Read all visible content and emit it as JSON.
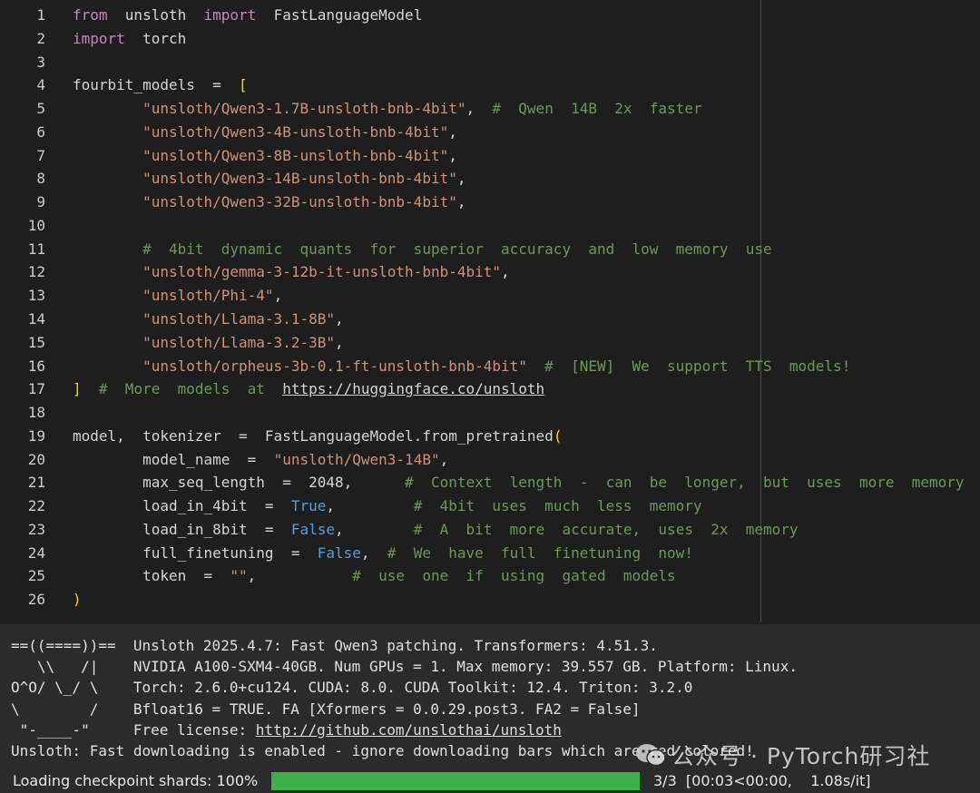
{
  "code_lines": [
    {
      "n": "1",
      "tokens": [
        {
          "t": "from",
          "c": "kw"
        },
        {
          "t": "  unsloth  "
        },
        {
          "t": "import",
          "c": "kw"
        },
        {
          "t": "  FastLanguageModel"
        }
      ]
    },
    {
      "n": "2",
      "tokens": [
        {
          "t": "import",
          "c": "kw"
        },
        {
          "t": "  torch"
        }
      ]
    },
    {
      "n": "3",
      "tokens": []
    },
    {
      "n": "4",
      "tokens": [
        {
          "t": "fourbit_models  =  "
        },
        {
          "t": "[",
          "c": "br"
        }
      ]
    },
    {
      "n": "5",
      "tokens": [
        {
          "t": "        "
        },
        {
          "t": "\"unsloth/Qwen3-1.7B-unsloth-bnb-4bit\"",
          "c": "str"
        },
        {
          "t": ",  "
        },
        {
          "t": "#  Qwen  14B  2x  faster",
          "c": "cm"
        }
      ]
    },
    {
      "n": "6",
      "tokens": [
        {
          "t": "        "
        },
        {
          "t": "\"unsloth/Qwen3-4B-unsloth-bnb-4bit\"",
          "c": "str"
        },
        {
          "t": ","
        }
      ]
    },
    {
      "n": "7",
      "tokens": [
        {
          "t": "        "
        },
        {
          "t": "\"unsloth/Qwen3-8B-unsloth-bnb-4bit\"",
          "c": "str"
        },
        {
          "t": ","
        }
      ]
    },
    {
      "n": "8",
      "tokens": [
        {
          "t": "        "
        },
        {
          "t": "\"unsloth/Qwen3-14B-unsloth-bnb-4bit\"",
          "c": "str"
        },
        {
          "t": ","
        }
      ]
    },
    {
      "n": "9",
      "tokens": [
        {
          "t": "        "
        },
        {
          "t": "\"unsloth/Qwen3-32B-unsloth-bnb-4bit\"",
          "c": "str"
        },
        {
          "t": ","
        }
      ]
    },
    {
      "n": "10",
      "tokens": []
    },
    {
      "n": "11",
      "tokens": [
        {
          "t": "        "
        },
        {
          "t": "#  4bit  dynamic  quants  for  superior  accuracy  and  low  memory  use",
          "c": "cm"
        }
      ]
    },
    {
      "n": "12",
      "tokens": [
        {
          "t": "        "
        },
        {
          "t": "\"unsloth/gemma-3-12b-it-unsloth-bnb-4bit\"",
          "c": "str"
        },
        {
          "t": ","
        }
      ]
    },
    {
      "n": "13",
      "tokens": [
        {
          "t": "        "
        },
        {
          "t": "\"unsloth/Phi-4\"",
          "c": "str"
        },
        {
          "t": ","
        }
      ]
    },
    {
      "n": "14",
      "tokens": [
        {
          "t": "        "
        },
        {
          "t": "\"unsloth/Llama-3.1-8B\"",
          "c": "str"
        },
        {
          "t": ","
        }
      ]
    },
    {
      "n": "15",
      "tokens": [
        {
          "t": "        "
        },
        {
          "t": "\"unsloth/Llama-3.2-3B\"",
          "c": "str"
        },
        {
          "t": ","
        }
      ]
    },
    {
      "n": "16",
      "tokens": [
        {
          "t": "        "
        },
        {
          "t": "\"unsloth/orpheus-3b-0.1-ft-unsloth-bnb-4bit\"",
          "c": "str"
        },
        {
          "t": "  "
        },
        {
          "t": "#  [NEW]  We  support  TTS  models!",
          "c": "cm"
        }
      ]
    },
    {
      "n": "17",
      "tokens": [
        {
          "t": "]",
          "c": "br"
        },
        {
          "t": "  "
        },
        {
          "t": "#  More  models  at  ",
          "c": "cm"
        },
        {
          "t": "https://huggingface.co/unsloth",
          "c": "url"
        }
      ]
    },
    {
      "n": "18",
      "tokens": []
    },
    {
      "n": "19",
      "tokens": [
        {
          "t": "model,  tokenizer  =  FastLanguageModel.from_pretrained"
        },
        {
          "t": "(",
          "c": "br"
        }
      ]
    },
    {
      "n": "20",
      "tokens": [
        {
          "t": "        model_name  =  "
        },
        {
          "t": "\"unsloth/Qwen3-14B\"",
          "c": "str"
        },
        {
          "t": ","
        }
      ]
    },
    {
      "n": "21",
      "tokens": [
        {
          "t": "        max_seq_length  =  2048,      "
        },
        {
          "t": "#  Context  length  -  can  be  longer,  but  uses  more  memory",
          "c": "cm"
        }
      ]
    },
    {
      "n": "22",
      "tokens": [
        {
          "t": "        load_in_4bit  =  "
        },
        {
          "t": "True",
          "c": "bool"
        },
        {
          "t": ",         "
        },
        {
          "t": "#  4bit  uses  much  less  memory",
          "c": "cm"
        }
      ]
    },
    {
      "n": "23",
      "tokens": [
        {
          "t": "        load_in_8bit  =  "
        },
        {
          "t": "False",
          "c": "bool"
        },
        {
          "t": ",        "
        },
        {
          "t": "#  A  bit  more  accurate,  uses  2x  memory",
          "c": "cm"
        }
      ]
    },
    {
      "n": "24",
      "tokens": [
        {
          "t": "        full_finetuning  =  "
        },
        {
          "t": "False",
          "c": "bool"
        },
        {
          "t": ",  "
        },
        {
          "t": "#  We  have  full  finetuning  now!",
          "c": "cm"
        }
      ]
    },
    {
      "n": "25",
      "tokens": [
        {
          "t": "        token  =  "
        },
        {
          "t": "\"\"",
          "c": "str"
        },
        {
          "t": ",           "
        },
        {
          "t": "#  use  one  if  using  gated  models",
          "c": "cm"
        }
      ]
    },
    {
      "n": "26",
      "tokens": [
        {
          "t": ")",
          "c": "br"
        }
      ]
    }
  ],
  "output": {
    "lines": [
      {
        "banner": "==((====))==  ",
        "text": "Unsloth 2025.4.7: Fast Qwen3 patching. Transformers: 4.51.3."
      },
      {
        "banner": "   \\\\   /|    ",
        "text": "NVIDIA A100-SXM4-40GB. Num GPUs = 1. Max memory: 39.557 GB. Platform: Linux."
      },
      {
        "banner": "O^O/ \\_/ \\    ",
        "text": "Torch: 2.6.0+cu124. CUDA: 8.0. CUDA Toolkit: 12.4. Triton: 3.2.0"
      },
      {
        "banner": "\\        /    ",
        "text": "Bfloat16 = TRUE. FA [Xformers = 0.0.29.post3. FA2 = False]"
      },
      {
        "banner": " \"-____-\"     ",
        "text": "Free license: ",
        "url": "http://github.com/unslothai/unsloth"
      },
      {
        "banner": "",
        "text": "Unsloth: Fast downloading is enabled - ignore downloading bars which are red colored!"
      }
    ],
    "progress": {
      "label": "Loading checkpoint shards: 100%",
      "fraction": 1.0,
      "count": "3/3  [00:03<00:00,    1.08s/it]",
      "bar_color": "#3bb24a"
    }
  },
  "watermark": {
    "text": "公众号 · PyTorch研习社",
    "icon": "wechat-icon"
  },
  "colors": {
    "keyword": "#c586c0",
    "string": "#ce9178",
    "comment": "#6a9955",
    "boolean": "#569cd6",
    "bracket": "#ffd700",
    "text": "#d4d4d4",
    "background": "#1e1e1e",
    "output_background": "#2b2b2b"
  }
}
